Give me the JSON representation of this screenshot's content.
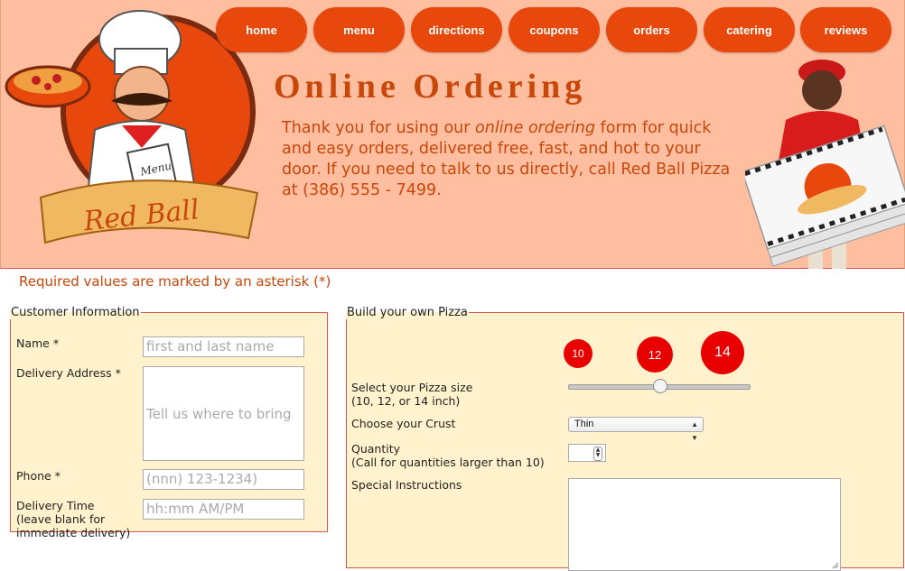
{
  "nav": {
    "items": [
      {
        "label": "home"
      },
      {
        "label": "menu"
      },
      {
        "label": "directions"
      },
      {
        "label": "coupons"
      },
      {
        "label": "orders"
      },
      {
        "label": "catering"
      },
      {
        "label": "reviews"
      }
    ]
  },
  "header": {
    "title": "Online Ordering",
    "intro_1": "Thank you for using our ",
    "intro_em": "online ordering",
    "intro_2": " form for quick and easy orders, delivered free, fast, and hot to your door. If you need to talk to us directly, call Red Ball Pizza at (386) 555 - 7499.",
    "logo_text": "Red Ball",
    "logo_menu_text": "Menu"
  },
  "form": {
    "required_note": "Required values are marked by an asterisk (*)",
    "customer": {
      "legend": "Customer Information",
      "name_label": "Name *",
      "name_placeholder": "first and last name",
      "address_label": "Delivery Address *",
      "address_placeholder": "Tell us where to bring",
      "phone_label": "Phone *",
      "phone_placeholder": "(nnn) 123-1234)",
      "time_label": "Delivery Time",
      "time_note_1": "(leave blank for",
      "time_note_2": "immediate delivery)",
      "time_placeholder": "hh:mm AM/PM"
    },
    "pizza": {
      "legend": "Build your own Pizza",
      "sizes": [
        "10",
        "12",
        "14"
      ],
      "selected_size": "14",
      "size_label": "Select your Pizza size",
      "size_note": "(10, 12, or 14 inch)",
      "size_slider_fraction": 0.5,
      "crust_label": "Choose your Crust",
      "crust_value": "Thin",
      "quantity_label": "Quantity",
      "quantity_note": "(Call for quantities larger than 10)",
      "instructions_label": "Special Instructions"
    }
  },
  "colors": {
    "header_bg": "#ffbe9f",
    "nav_button": "#e8480c",
    "accent_text": "#c8470a",
    "fieldset_bg": "#fff2cc",
    "size_circle": "#e80000"
  }
}
